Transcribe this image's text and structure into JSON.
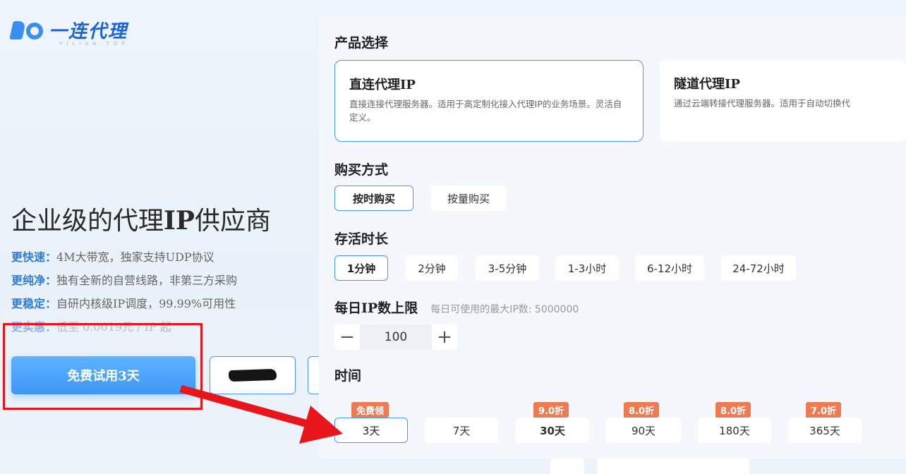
{
  "logo": {
    "text": "一连代理",
    "sub": "YILIAN.TOP"
  },
  "hero": {
    "title_a": "企业级的代理",
    "title_b": "IP",
    "title_c": "供应商",
    "features": [
      {
        "k": "更快速：",
        "v": "4M大带宽，独家支持UDP协议"
      },
      {
        "k": "更纯净：",
        "v": "独有全新的自营线路，非第三方采购"
      },
      {
        "k": "更稳定：",
        "v": "自研内核级IP调度，99.99%可用性"
      },
      {
        "k": "更实惠：",
        "v": "低至 0.0019元 / IP 起"
      }
    ],
    "trial_button": "免费试用3天"
  },
  "panel": {
    "product_heading": "产品选择",
    "products": [
      {
        "title": "直连代理IP",
        "desc": "直接连接代理服务器。适用于高定制化接入代理IP的业务场景。灵活自定义。"
      },
      {
        "title": "隧道代理IP",
        "desc": "通过云端转接代理服务器。适用于自动切换代"
      }
    ],
    "purchase_heading": "购买方式",
    "purchase_options": [
      "按时购买",
      "按量购买"
    ],
    "duration_heading": "存活时长",
    "durations": [
      "1分钟",
      "2分钟",
      "3-5分钟",
      "1-3小时",
      "6-12小时",
      "24-72小时"
    ],
    "ip_limit_heading": "每日IP数上限",
    "ip_limit_note": "每日可使用的最大IP数: 5000000",
    "ip_limit_value": "100",
    "time_heading": "时间",
    "times": [
      {
        "label": "3天",
        "badge": "免费领"
      },
      {
        "label": "7天",
        "badge": ""
      },
      {
        "label": "30天",
        "badge": "9.0折"
      },
      {
        "label": "90天",
        "badge": "8.0折"
      },
      {
        "label": "180天",
        "badge": "8.0折"
      },
      {
        "label": "365天",
        "badge": "7.0折"
      }
    ]
  },
  "colors": {
    "accent": "#4a96f0",
    "badge": "#ef7a52",
    "annotation": "#e8161a"
  }
}
